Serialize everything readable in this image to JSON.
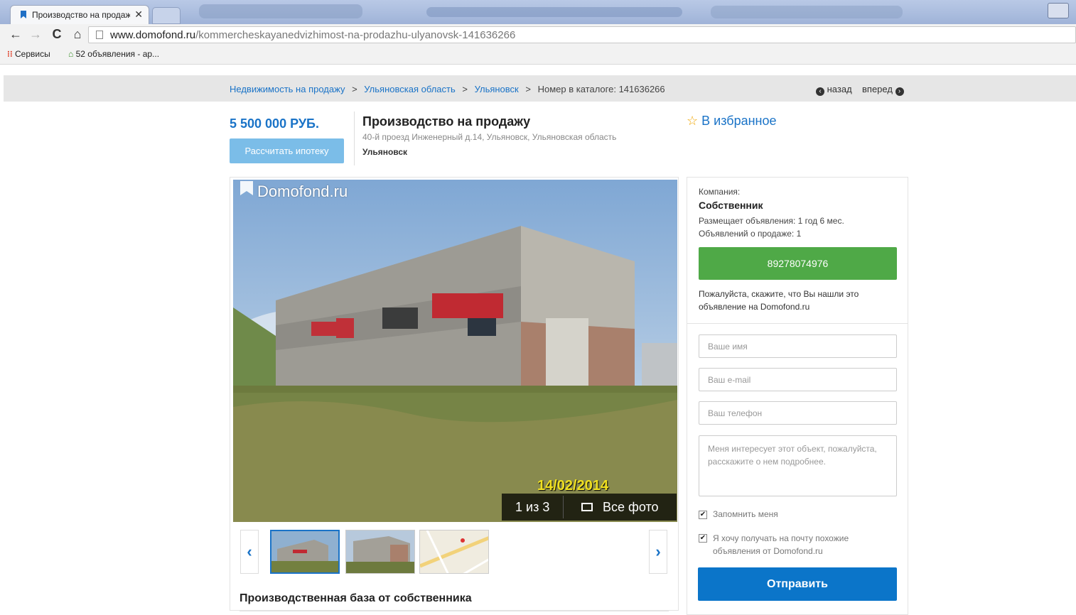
{
  "browser": {
    "tab_title": "Производство на продаж",
    "url_domain": "www.domofond.ru",
    "url_path": "/kommercheskayanedvizhimost-na-prodazhu-ulyanovsk-141636266",
    "bookmarks": [
      {
        "label": "Сервисы",
        "icon": "apps-grid-icon"
      },
      {
        "label": "52 объявления - ар...",
        "icon": "bookmark-favicon-icon"
      }
    ]
  },
  "breadcrumb": {
    "items": [
      "Недвижимость на продажу",
      "Ульяновская область",
      "Ульяновск"
    ],
    "separator": ">",
    "catalog": "Номер в каталоге: 141636266",
    "back": "назад",
    "forward": "вперед"
  },
  "listing": {
    "price": "5 500 000 РУБ.",
    "mortgage_button": "Рассчитать ипотеку",
    "title": "Производство на продажу",
    "address": "40-й проезд Инженерный д.14, Ульяновск, Ульяновская область",
    "city": "Ульяновск",
    "favorite": "В избранное"
  },
  "gallery": {
    "watermark": "Domofond.ru",
    "photo_date": "14/02/2014",
    "counter": "1 из 3",
    "all_photos": "Все фото",
    "prev": "‹",
    "next": "›"
  },
  "description": {
    "heading": "Производственная база от собственника"
  },
  "contact": {
    "company_label": "Компания:",
    "company_name": "Собственник",
    "posting_since": "Размещает объявления: 1 год 6 мес.",
    "ads_count": "Объявлений о продаже: 1",
    "phone": "89278074976",
    "please_note": "Пожалуйста, скажите, что Вы нашли это объявление на Domofond.ru"
  },
  "form": {
    "name_placeholder": "Ваше имя",
    "email_placeholder": "Ваш e-mail",
    "phone_placeholder": "Ваш телефон",
    "message_placeholder": "Меня интересует этот объект, пожалуйста, расскажите о нем подробнее.",
    "remember_me": "Запомнить меня",
    "subscribe": "Я хочу получать на почту похожие объявления от Domofond.ru",
    "submit": "Отправить"
  },
  "colors": {
    "link": "#1a73c7",
    "phone_button": "#4fa947",
    "submit_button": "#0b75c9",
    "mortgage_button": "#7bbde8"
  }
}
